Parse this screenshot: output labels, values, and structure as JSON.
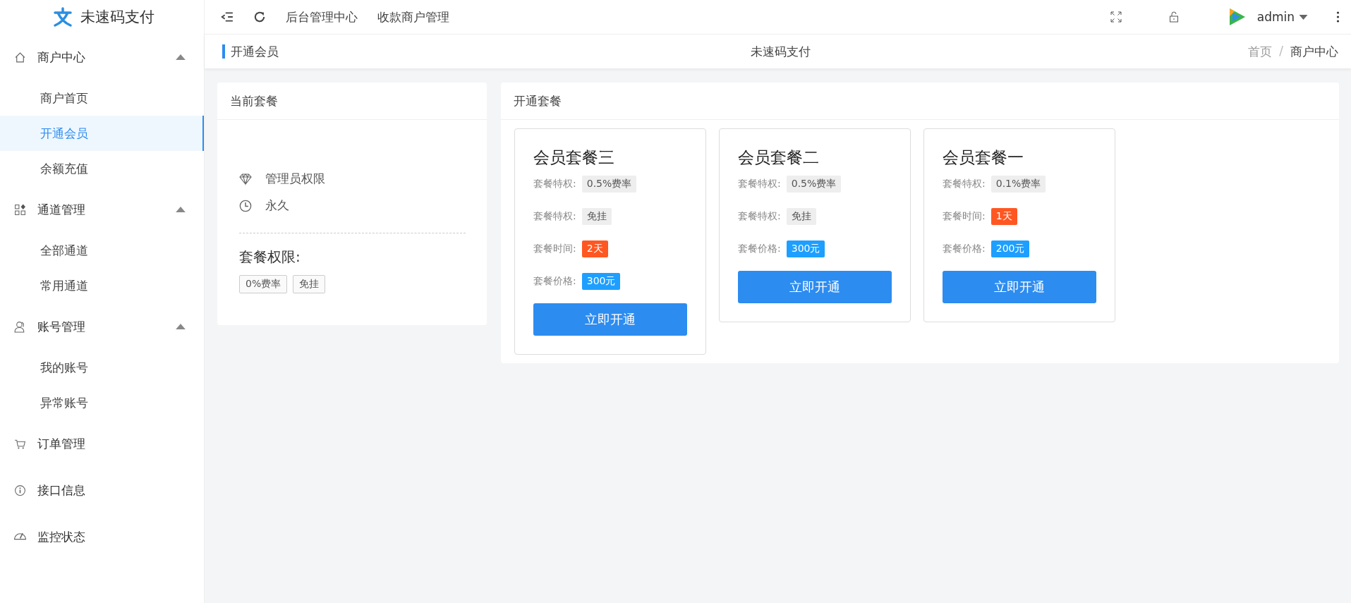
{
  "brand": {
    "name": "未速码支付"
  },
  "top_nav": [
    "后台管理中心",
    "收款商户管理"
  ],
  "user": {
    "name": "admin"
  },
  "sidebar": {
    "groups": [
      {
        "label": "商户中心",
        "expanded": true,
        "children": [
          {
            "label": "商户首页",
            "selected": false
          },
          {
            "label": "开通会员",
            "selected": true
          },
          {
            "label": "余额充值",
            "selected": false
          }
        ]
      },
      {
        "label": "通道管理",
        "expanded": true,
        "children": [
          {
            "label": "全部通道",
            "selected": false
          },
          {
            "label": "常用通道",
            "selected": false
          }
        ]
      },
      {
        "label": "账号管理",
        "expanded": true,
        "children": [
          {
            "label": "我的账号",
            "selected": false
          },
          {
            "label": "异常账号",
            "selected": false
          }
        ]
      },
      {
        "label": "订单管理"
      },
      {
        "label": "接口信息"
      },
      {
        "label": "监控状态"
      }
    ]
  },
  "page_header": {
    "title": "开通会员",
    "center_title": "未速码支付",
    "breadcrumb": [
      "首页",
      "商户中心"
    ],
    "breadcrumb_separator": "/"
  },
  "current_plan": {
    "title": "当前套餐",
    "role": "管理员权限",
    "duration": "永久",
    "perms_label": "套餐权限:",
    "perms": [
      "0%费率",
      "免挂"
    ]
  },
  "plans": {
    "title": "开通套餐",
    "items": [
      {
        "name": "会员套餐三",
        "rows": [
          {
            "label": "套餐特权:",
            "value": "0.5%费率",
            "kind": "feature"
          },
          {
            "label": "套餐特权:",
            "value": "免挂",
            "kind": "feature"
          },
          {
            "label": "套餐时间:",
            "value": "2天",
            "kind": "time"
          },
          {
            "label": "套餐价格:",
            "value": "300元",
            "kind": "price"
          }
        ],
        "button": "立即开通"
      },
      {
        "name": "会员套餐二",
        "rows": [
          {
            "label": "套餐特权:",
            "value": "0.5%费率",
            "kind": "feature"
          },
          {
            "label": "套餐特权:",
            "value": "免挂",
            "kind": "feature"
          },
          {
            "label": "套餐价格:",
            "value": "300元",
            "kind": "price"
          }
        ],
        "button": "立即开通"
      },
      {
        "name": "会员套餐一",
        "rows": [
          {
            "label": "套餐特权:",
            "value": "0.1%费率",
            "kind": "feature"
          },
          {
            "label": "套餐时间:",
            "value": "1天",
            "kind": "time"
          },
          {
            "label": "套餐价格:",
            "value": "200元",
            "kind": "price"
          }
        ],
        "button": "立即开通"
      }
    ]
  }
}
